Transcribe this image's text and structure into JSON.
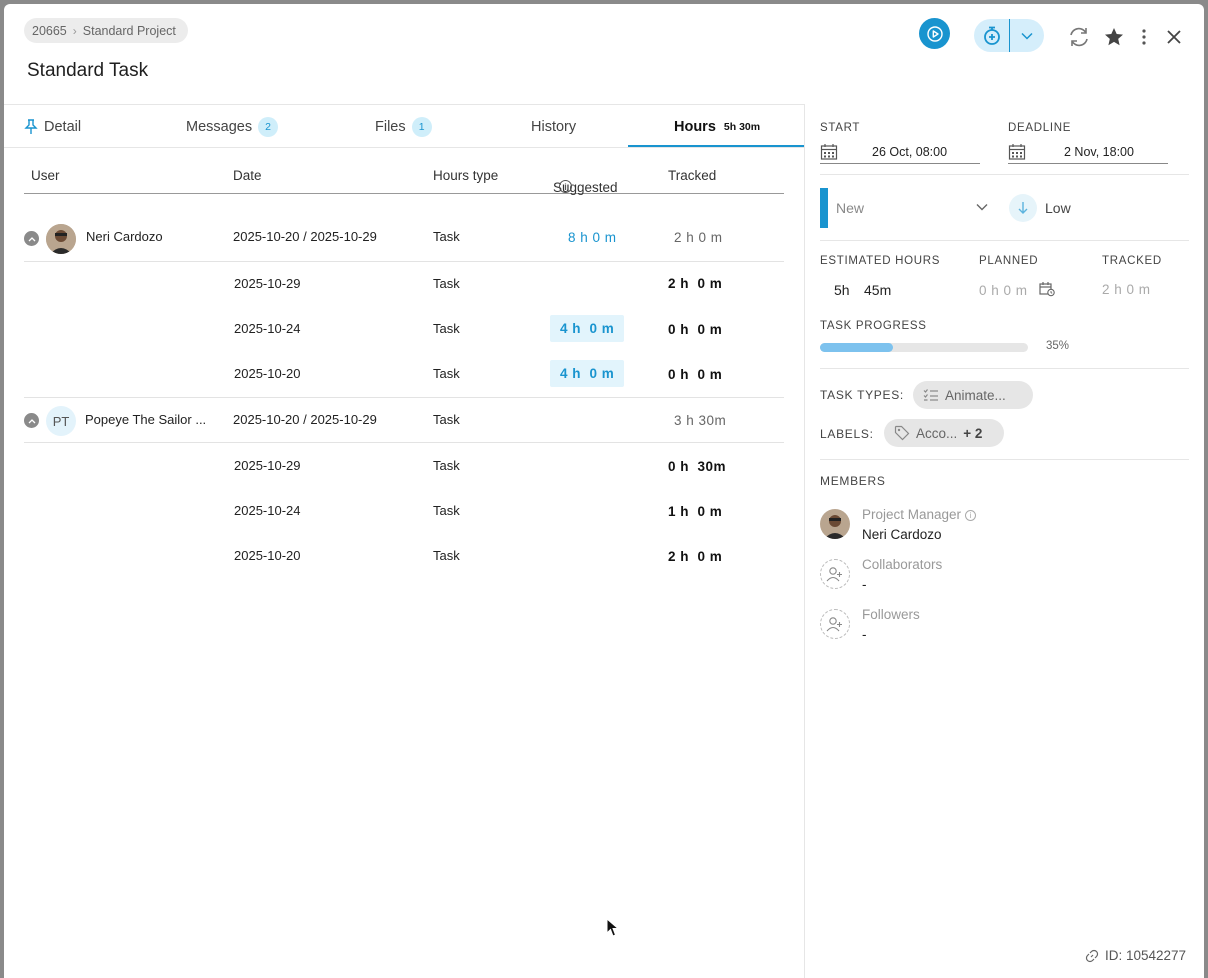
{
  "header": {
    "breadcrumb_id": "20665",
    "breadcrumb_project": "Standard Project",
    "title": "Standard Task"
  },
  "tabs": [
    {
      "label": "Detail",
      "badge": ""
    },
    {
      "label": "Messages",
      "badge": "2"
    },
    {
      "label": "Files",
      "badge": "1"
    },
    {
      "label": "History",
      "badge": ""
    },
    {
      "label": "Hours",
      "badge": "5h 30m"
    }
  ],
  "table": {
    "headers": {
      "user": "User",
      "date": "Date",
      "hours_type": "Hours type",
      "suggested": "Suggested",
      "tracked": "Tracked"
    },
    "groups": [
      {
        "user": "Neri Cardozo",
        "date": "2025-10-20 / 2025-10-29",
        "type": "Task",
        "suggested": "8 h 0 m",
        "tracked": "2 h 0 m",
        "rows": [
          {
            "date": "2025-10-29",
            "type": "Task",
            "suggested": "",
            "tracked": "2 h  0 m"
          },
          {
            "date": "2025-10-24",
            "type": "Task",
            "suggested": "4 h  0 m",
            "tracked": "0 h  0 m"
          },
          {
            "date": "2025-10-20",
            "type": "Task",
            "suggested": "4 h  0 m",
            "tracked": "0 h  0 m"
          }
        ]
      },
      {
        "user": "Popeye The Sailor ...",
        "initials": "PT",
        "date": "2025-10-20 / 2025-10-29",
        "type": "Task",
        "suggested": "",
        "tracked": "3 h 30m",
        "rows": [
          {
            "date": "2025-10-29",
            "type": "Task",
            "suggested": "",
            "tracked": "0 h  30m"
          },
          {
            "date": "2025-10-24",
            "type": "Task",
            "suggested": "",
            "tracked": "1 h  0 m"
          },
          {
            "date": "2025-10-20",
            "type": "Task",
            "suggested": "",
            "tracked": "2 h  0 m"
          }
        ]
      }
    ]
  },
  "panel": {
    "start_label": "START",
    "start_value": "26 Oct, 08:00",
    "deadline_label": "DEADLINE",
    "deadline_value": "2 Nov, 18:00",
    "status": "New",
    "priority": "Low",
    "est_label": "ESTIMATED HOURS",
    "est_h": "5h",
    "est_m": "45m",
    "planned_label": "PLANNED",
    "planned_value": "0 h 0 m",
    "tracked_label": "TRACKED",
    "tracked_value": "2 h 0 m",
    "progress_label": "TASK PROGRESS",
    "progress_pct": 35,
    "progress_text": "35%",
    "task_types_label": "TASK TYPES:",
    "task_type": "Animate...",
    "labels_label": "LABELS:",
    "label_value": "Acco...",
    "label_more": "+ 2",
    "members_label": "MEMBERS",
    "pm_role": "Project Manager",
    "pm_name": "Neri Cardozo",
    "collab_role": "Collaborators",
    "collab_value": "-",
    "followers_role": "Followers",
    "followers_value": "-",
    "id_text": "ID: 10542277"
  },
  "colors": {
    "accent": "#1994cf",
    "accent_light": "#d5eefb",
    "progress": "#7dc2ee"
  }
}
